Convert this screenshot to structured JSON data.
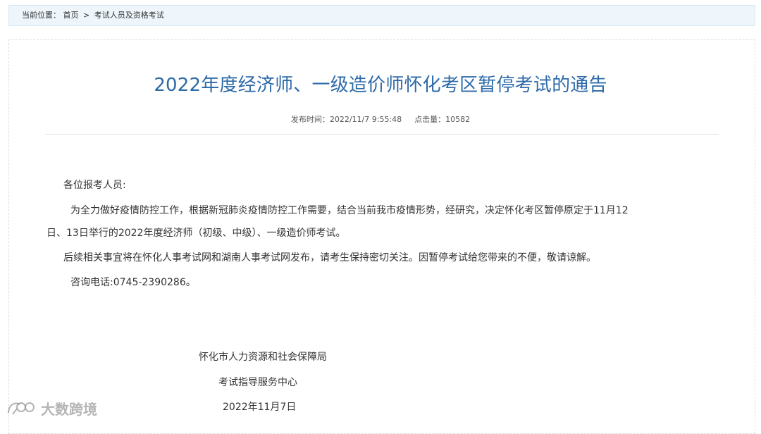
{
  "breadcrumb": {
    "label": "当前位置：",
    "home": "首页",
    "separator": ">",
    "current": "考试人员及资格考试"
  },
  "article": {
    "title": "2022年度经济师、一级造价师怀化考区暂停考试的通告",
    "publish_label": "发布时间：",
    "publish_time": "2022/11/7 9:55:48",
    "views_label": "点击量：",
    "views": "10582",
    "greeting": "各位报考人员:",
    "para1_line1": "为全力做好疫情防控工作，根据新冠肺炎疫情防控工作需要，结合当前我市疫情形势，经研究，决定怀化考区暂停原定于11月12",
    "para1_line2": "日、13日举行的2022年度经济师（初级、中级）、一级造价师考试。",
    "para2": "后续相关事宜将在怀化人事考试网和湖南人事考试网发布，请考生保持密切关注。因暂停考试给您带来的不便，敬请谅解。",
    "contact": "咨询电话:0745-2390286。",
    "signature_org": "怀化市人力资源和社会保障局",
    "signature_dept": "考试指导服务中心",
    "signature_date": "2022年11月7日"
  },
  "watermark": {
    "text": "大数跨境"
  }
}
